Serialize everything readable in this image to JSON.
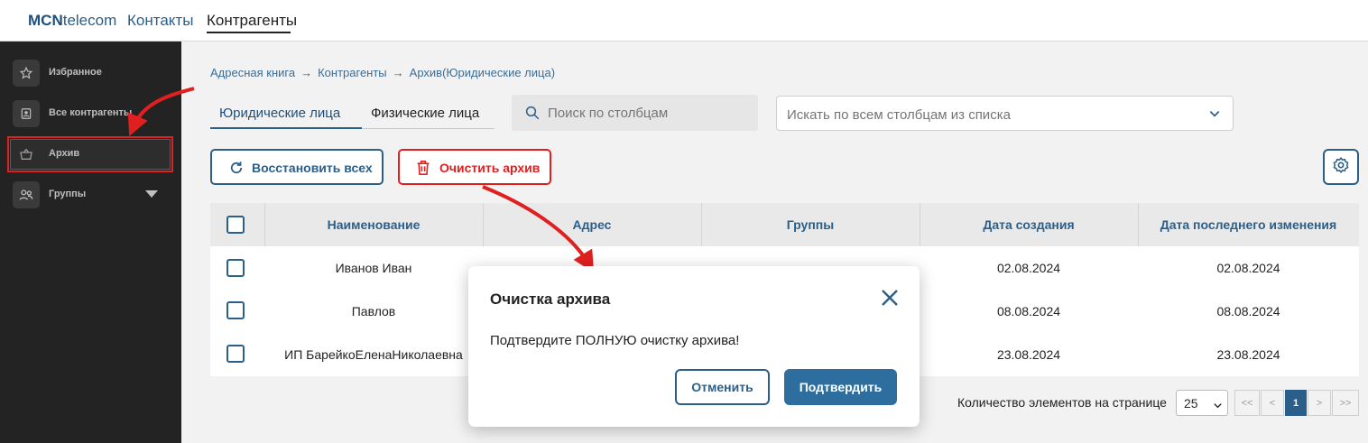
{
  "header": {
    "brand_bold": "MCN",
    "brand_rest": "telecom",
    "nav": [
      "Контакты",
      "Контрагенты"
    ]
  },
  "sidebar": {
    "items": [
      {
        "label": "Избранное",
        "icon": "star-icon"
      },
      {
        "label": "Все контрагенты",
        "icon": "contact-card-icon"
      },
      {
        "label": "Архив",
        "icon": "basket-icon"
      },
      {
        "label": "Группы",
        "icon": "users-icon"
      }
    ]
  },
  "breadcrumb": [
    "Адресная книга",
    "Контрагенты",
    "Архив(Юридические лица)"
  ],
  "breadcrumb_sep": "→",
  "tabs": [
    "Юридические лица",
    "Физические лица"
  ],
  "search": {
    "columns_placeholder": "Поиск по столбцам",
    "all_placeholder": "Искать по всем столбцам из списка"
  },
  "toolbar": {
    "restore_label": "Восстановить всех",
    "clear_label": "Очистить архив"
  },
  "table": {
    "headers": [
      "Наименование",
      "Адрес",
      "Группы",
      "Дата создания",
      "Дата последнего изменения"
    ],
    "rows": [
      {
        "name": "Иванов Иван",
        "address": "",
        "groups": "",
        "created": "02.08.2024",
        "modified": "02.08.2024"
      },
      {
        "name": "Павлов",
        "address": "",
        "groups": "",
        "created": "08.08.2024",
        "modified": "08.08.2024"
      },
      {
        "name": "ИП БарейкоЕленаНиколаевна",
        "address": "",
        "groups": "",
        "created": "23.08.2024",
        "modified": "23.08.2024"
      }
    ]
  },
  "pagination": {
    "label": "Количество элементов на странице",
    "page_size": "25",
    "buttons": [
      "<<",
      "<",
      "1",
      ">",
      ">>"
    ],
    "current_page": "1"
  },
  "modal": {
    "title": "Очистка архива",
    "message": "Подтвердите ПОЛНУЮ очистку архива!",
    "cancel_label": "Отменить",
    "confirm_label": "Подтвердить"
  },
  "colors": {
    "accent": "#2b5f8a",
    "danger": "#e02020",
    "sidebar_bg": "#232323"
  }
}
